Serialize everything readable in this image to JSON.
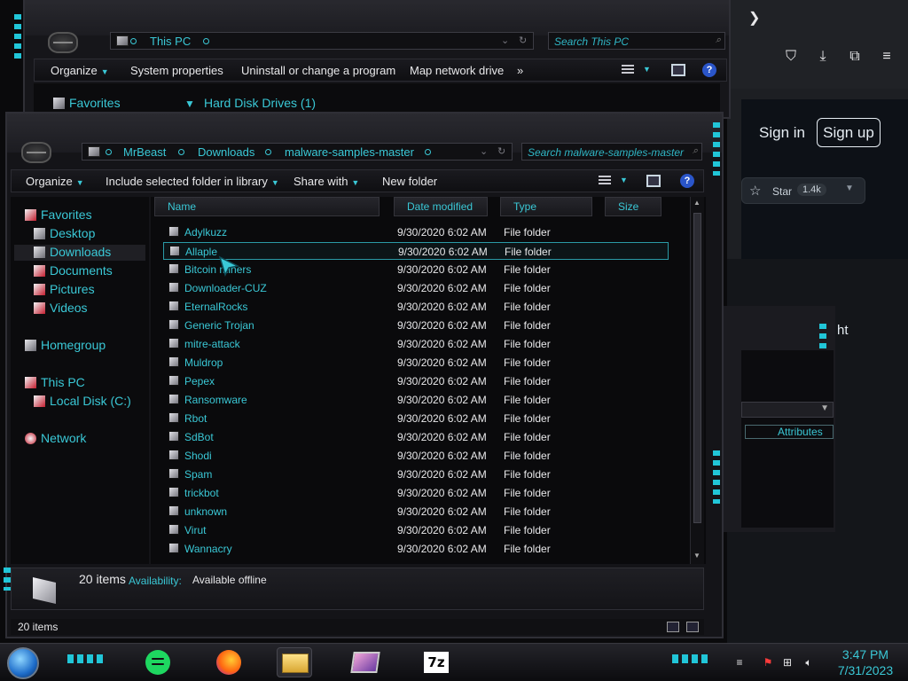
{
  "browser": {
    "sign_in": "Sign in",
    "sign_up": "Sign up",
    "star_label": "Star",
    "star_count": "1.4k",
    "partial_text": "ht"
  },
  "back_window": {
    "address": "This PC",
    "search_placeholder": "Search This PC",
    "toolbar": [
      "Organize",
      "System properties",
      "Uninstall or change a program",
      "Map network drive",
      "»"
    ],
    "nav_favorites": "Favorites",
    "group_header": "Hard Disk Drives (1)"
  },
  "third_window": {
    "attributes_tab": "Attributes"
  },
  "main_window": {
    "breadcrumbs": [
      "MrBeast",
      "Downloads",
      "malware-samples-master"
    ],
    "search_placeholder": "Search malware-samples-master",
    "toolbar": {
      "organize": "Organize",
      "include": "Include selected folder in library",
      "share": "Share with",
      "new_folder": "New folder"
    },
    "nav": {
      "favorites": "Favorites",
      "desktop": "Desktop",
      "downloads": "Downloads",
      "documents": "Documents",
      "pictures": "Pictures",
      "videos": "Videos",
      "homegroup": "Homegroup",
      "this_pc": "This PC",
      "local_disk": "Local Disk (C:)",
      "network": "Network"
    },
    "columns": [
      "Name",
      "Date modified",
      "Type",
      "Size"
    ],
    "selected_index": 1,
    "files": [
      {
        "name": "Adylkuzz",
        "date": "9/30/2020 6:02 AM",
        "type": "File folder"
      },
      {
        "name": "Allaple",
        "date": "9/30/2020 6:02 AM",
        "type": "File folder"
      },
      {
        "name": "Bitcoin miners",
        "date": "9/30/2020 6:02 AM",
        "type": "File folder"
      },
      {
        "name": "Downloader-CUZ",
        "date": "9/30/2020 6:02 AM",
        "type": "File folder"
      },
      {
        "name": "EternalRocks",
        "date": "9/30/2020 6:02 AM",
        "type": "File folder"
      },
      {
        "name": "Generic Trojan",
        "date": "9/30/2020 6:02 AM",
        "type": "File folder"
      },
      {
        "name": "mitre-attack",
        "date": "9/30/2020 6:02 AM",
        "type": "File folder"
      },
      {
        "name": "Muldrop",
        "date": "9/30/2020 6:02 AM",
        "type": "File folder"
      },
      {
        "name": "Pepex",
        "date": "9/30/2020 6:02 AM",
        "type": "File folder"
      },
      {
        "name": "Ransomware",
        "date": "9/30/2020 6:02 AM",
        "type": "File folder"
      },
      {
        "name": "Rbot",
        "date": "9/30/2020 6:02 AM",
        "type": "File folder"
      },
      {
        "name": "SdBot",
        "date": "9/30/2020 6:02 AM",
        "type": "File folder"
      },
      {
        "name": "Shodi",
        "date": "9/30/2020 6:02 AM",
        "type": "File folder"
      },
      {
        "name": "Spam",
        "date": "9/30/2020 6:02 AM",
        "type": "File folder"
      },
      {
        "name": "trickbot",
        "date": "9/30/2020 6:02 AM",
        "type": "File folder"
      },
      {
        "name": "unknown",
        "date": "9/30/2020 6:02 AM",
        "type": "File folder"
      },
      {
        "name": "Virut",
        "date": "9/30/2020 6:02 AM",
        "type": "File folder"
      },
      {
        "name": "Wannacry",
        "date": "9/30/2020 6:02 AM",
        "type": "File folder"
      }
    ],
    "details": {
      "count": "20 items",
      "availability_label": "Availability:",
      "availability_value": "Available offline"
    },
    "status": "20 items"
  },
  "taskbar": {
    "apps": [
      "spotify-icon",
      "firefox-icon",
      "file-explorer-icon",
      "screenshot-tool-icon",
      "7zip-icon"
    ],
    "sevenzip_label": "7z",
    "time": "3:47 PM",
    "date": "7/31/2023"
  },
  "colors": {
    "accent_cyan": "#3ac8d6",
    "window_bg": "#141418",
    "text_light": "#e8e8ea"
  }
}
